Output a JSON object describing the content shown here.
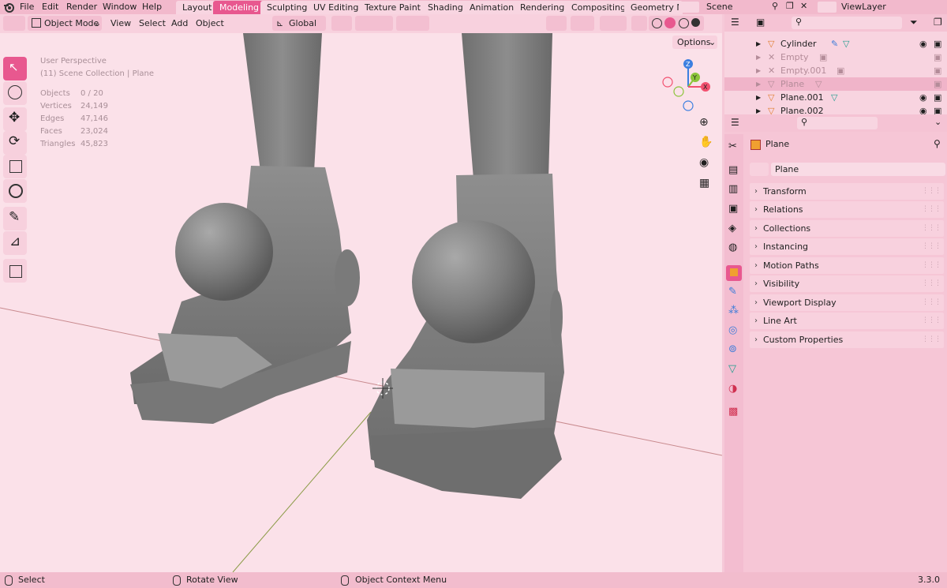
{
  "menu": {
    "file": "File",
    "edit": "Edit",
    "render": "Render",
    "window": "Window",
    "help": "Help"
  },
  "workspaces": [
    "Layout",
    "Modeling",
    "Sculpting",
    "UV Editing",
    "Texture Paint",
    "Shading",
    "Animation",
    "Rendering",
    "Compositing",
    "Geometry N"
  ],
  "active_workspace": "Modeling",
  "scene": "Scene",
  "view_layer": "ViewLayer",
  "viewport_header": {
    "mode": "Object Mode",
    "view": "View",
    "select": "Select",
    "add": "Add",
    "object": "Object",
    "orientation": "Global",
    "options": "Options"
  },
  "overlay": {
    "perspective": "User Perspective",
    "collection": "(11) Scene Collection | Plane",
    "stats": [
      {
        "label": "Objects",
        "value": "0 / 20"
      },
      {
        "label": "Vertices",
        "value": "24,149"
      },
      {
        "label": "Edges",
        "value": "47,146"
      },
      {
        "label": "Faces",
        "value": "23,024"
      },
      {
        "label": "Triangles",
        "value": "45,823"
      }
    ]
  },
  "gizmo": {
    "x": "X",
    "y": "Y",
    "z": "Z"
  },
  "outliner": {
    "rows": [
      {
        "name": "Cylinder",
        "dim": false
      },
      {
        "name": "Empty",
        "dim": true
      },
      {
        "name": "Empty.001",
        "dim": true
      },
      {
        "name": "Plane",
        "dim": true
      },
      {
        "name": "Plane.001",
        "dim": false
      },
      {
        "name": "Plane.002",
        "dim": false
      }
    ]
  },
  "properties": {
    "object_name": "Plane",
    "object_field": "Plane",
    "panels": [
      "Transform",
      "Relations",
      "Collections",
      "Instancing",
      "Motion Paths",
      "Visibility",
      "Viewport Display",
      "Line Art",
      "Custom Properties"
    ]
  },
  "statusbar": {
    "select": "Select",
    "rotate": "Rotate View",
    "context": "Object Context Menu",
    "version": "3.3.0"
  },
  "colors": {
    "accent": "#e8588f",
    "x_axis": "#f2506f",
    "y_axis": "#8bc43a",
    "z_axis": "#3c7fe0"
  }
}
